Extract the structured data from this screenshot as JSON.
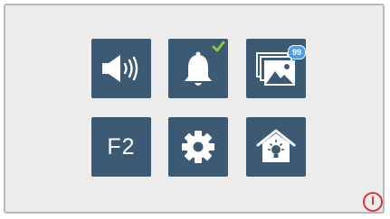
{
  "tiles": [
    {
      "name": "volume",
      "icon": "speaker-volume-icon"
    },
    {
      "name": "bell",
      "icon": "bell-icon",
      "status_icon": "checkmark-icon",
      "status_color": "#8cc63f"
    },
    {
      "name": "gallery",
      "icon": "photo-gallery-icon",
      "badge": "99"
    },
    {
      "name": "f2",
      "label": "F2"
    },
    {
      "name": "settings",
      "icon": "gear-icon"
    },
    {
      "name": "home-light",
      "icon": "home-light-icon"
    }
  ],
  "power_button": {
    "icon": "power-icon",
    "color": "#d42c2c"
  },
  "colors": {
    "tile": "#3d5a75",
    "background": "#ececec",
    "badge": "#4a9de0"
  }
}
